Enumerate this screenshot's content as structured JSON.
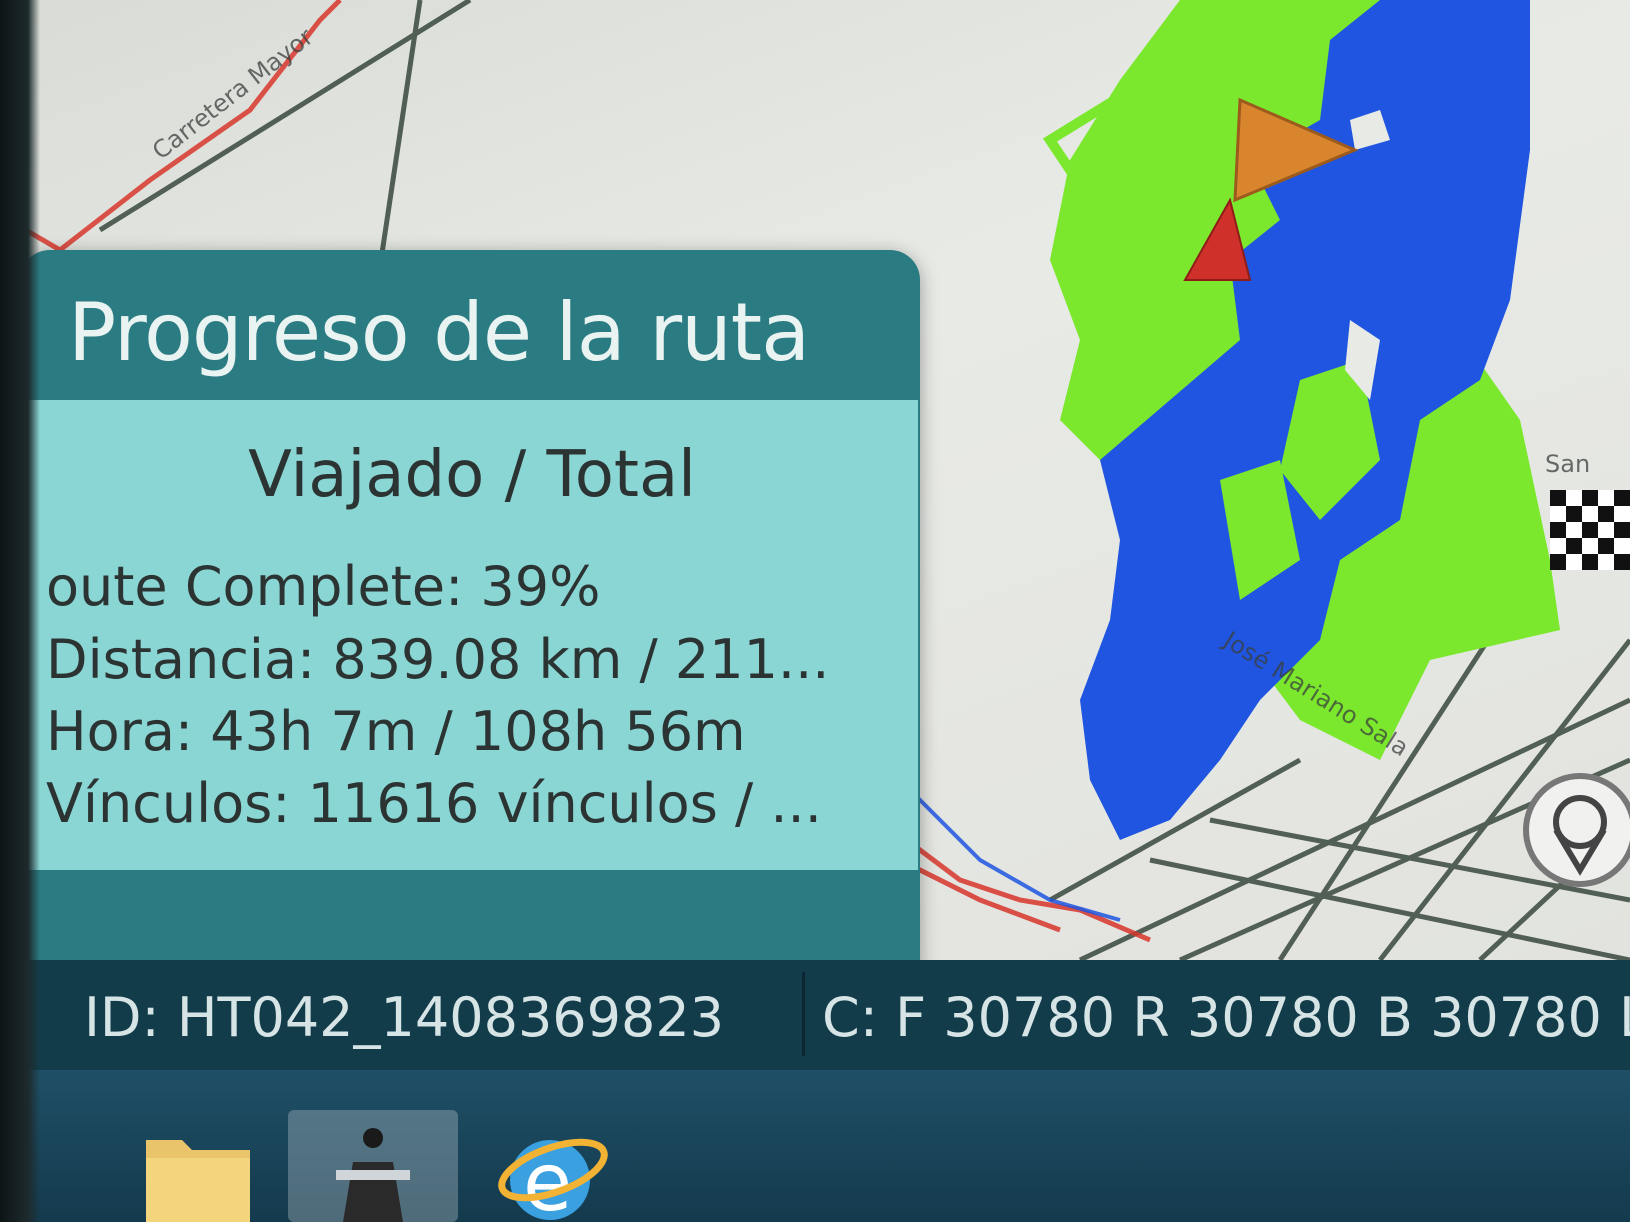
{
  "map": {
    "street_labels": {
      "top_left": "Carretera Mayor",
      "center": "José Mariano Sala",
      "right": "San"
    },
    "markers": {
      "current_position": "orange-triangle",
      "origin": "red-triangle",
      "destination": "checkered-flag"
    },
    "colors": {
      "coverage_blue": "#1f55e0",
      "coverage_green": "#7be82e",
      "route_red": "#d8362b",
      "roads_dark": "#2d3e33"
    }
  },
  "progress_panel": {
    "title": "Progreso de la ruta",
    "header": "Viajado / Total",
    "route_complete": "oute Complete: 39%",
    "distance": "Distancia: 839.08 km / 211...",
    "time": "Hora: 43h 7m / 108h 56m",
    "links": "Vínculos: 11616 vínculos / ..."
  },
  "status_bar": {
    "id": "ID: HT042_1408369823",
    "counters": "C: F 30780 R 30780 B 30780 L"
  },
  "taskbar": {
    "icons": [
      "folder-icon",
      "app-icon",
      "internet-explorer-icon"
    ]
  }
}
